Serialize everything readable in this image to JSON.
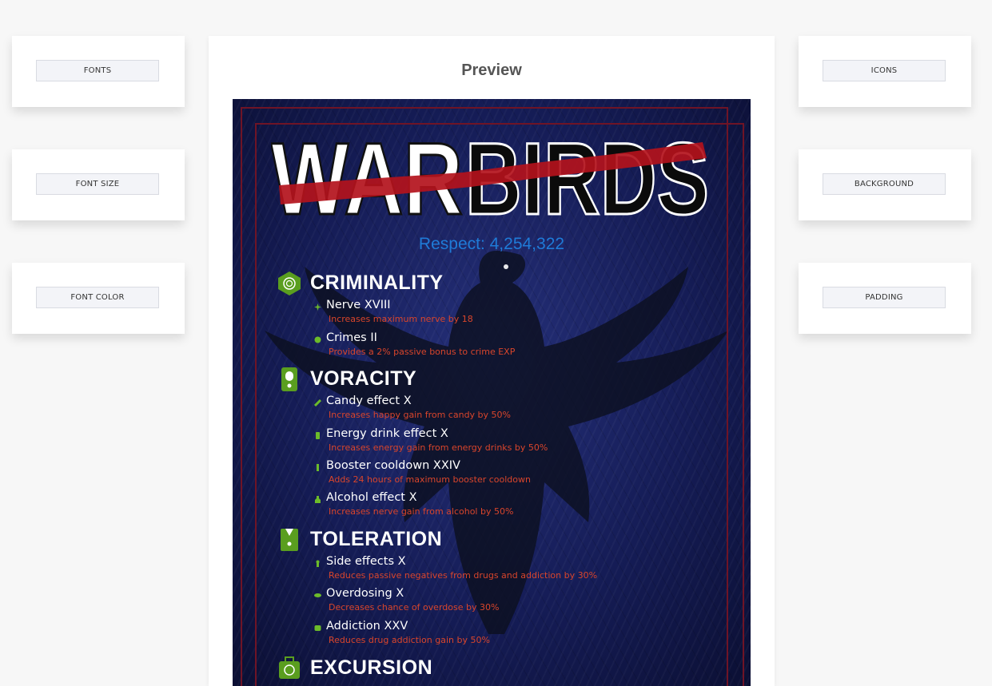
{
  "controls": {
    "fonts": "FONTS",
    "font_size": "FONT SIZE",
    "font_color": "FONT COLOR",
    "icons": "ICONS",
    "background": "BACKGROUND",
    "padding": "PADDING"
  },
  "preview": {
    "title": "Preview",
    "logo": {
      "part1": "WAR",
      "part2": "BIRDS"
    },
    "respect": "Respect: 4,254,322",
    "colors": {
      "title": "#ffffff",
      "perk_name": "#ffffff",
      "perk_desc": "#d9452b",
      "respect": "#1f7bd8"
    },
    "sections": [
      {
        "title": "CRIMINALITY",
        "icon": "fingerprint-icon",
        "perks": [
          {
            "name": "Nerve XVIII",
            "desc": "Increases maximum nerve by 18"
          },
          {
            "name": "Crimes II",
            "desc": "Provides a 2% passive bonus to crime EXP"
          }
        ]
      },
      {
        "title": "VORACITY",
        "icon": "canister-icon",
        "perks": [
          {
            "name": "Candy effect X",
            "desc": "Increases happy gain from candy by 50%"
          },
          {
            "name": "Energy drink effect X",
            "desc": "Increases energy gain from energy drinks by 50%"
          },
          {
            "name": "Booster cooldown XXIV",
            "desc": "Adds 24 hours of maximum booster cooldown"
          },
          {
            "name": "Alcohol effect X",
            "desc": "Increases nerve gain from alcohol by 50%"
          }
        ]
      },
      {
        "title": "TOLERATION",
        "icon": "suit-icon",
        "perks": [
          {
            "name": "Side effects X",
            "desc": "Reduces passive negatives from drugs and addiction by 30%"
          },
          {
            "name": "Overdosing X",
            "desc": "Decreases chance of overdose by 30%"
          },
          {
            "name": "Addiction XXV",
            "desc": "Reduces drug addiction gain by 50%"
          }
        ]
      },
      {
        "title": "EXCURSION",
        "icon": "suitcase-icon",
        "perks": []
      }
    ]
  }
}
